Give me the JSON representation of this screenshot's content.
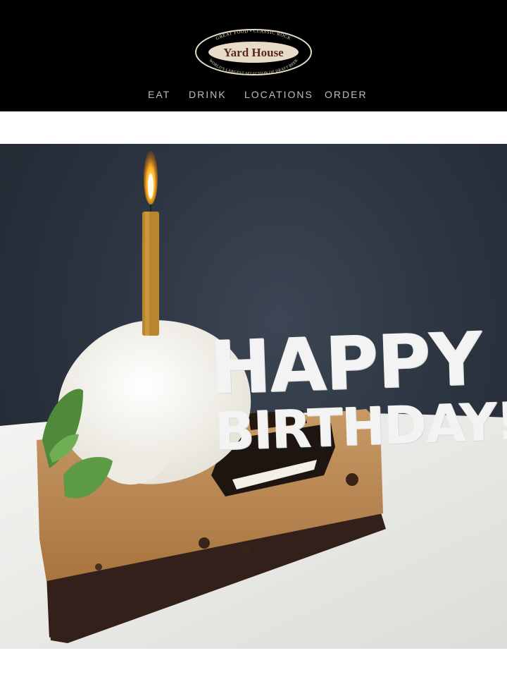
{
  "brand": {
    "name": "Yard House",
    "tagline_top": "GREAT FOOD • CLASSIC ROCK",
    "tagline_bottom": "WORLD'S LARGEST SELECTION OF DRAFT BEER",
    "colors": {
      "header_bg": "#000000",
      "logo_oval": "#e8dcc8",
      "logo_text": "#5a2a1a",
      "nav_text": "#bfbfbf"
    }
  },
  "nav": {
    "items": [
      {
        "label": "EAT"
      },
      {
        "label": "DRINK"
      },
      {
        "label": "LOCATIONS"
      },
      {
        "label": "ORDER"
      }
    ]
  },
  "hero": {
    "line1": "HAPPY",
    "line2": "BIRTHDAY!",
    "image_subject": "cookie-pie-slice-with-ice-cream-and-candle"
  }
}
